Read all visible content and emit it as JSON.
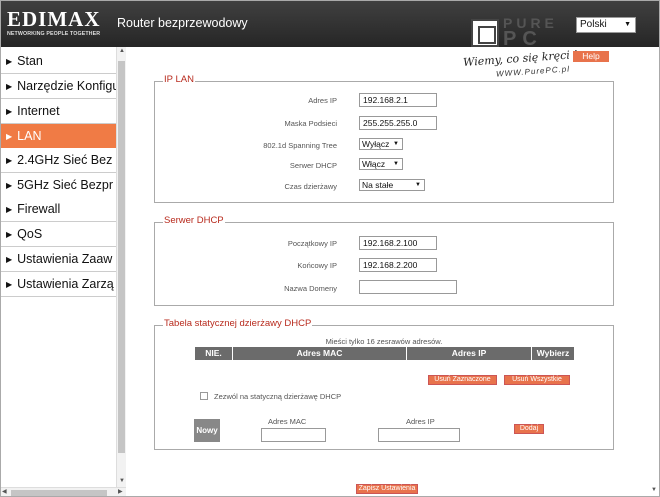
{
  "header": {
    "logo_main": "EDIMAX",
    "logo_sub": "NETWORKING PEOPLE TOGETHER",
    "title": "Router bezprzewodowy",
    "language": "Polski",
    "help_label": "Help"
  },
  "sidebar": {
    "items": [
      {
        "label": "Stan"
      },
      {
        "label": "Narzędzie Konfigu"
      },
      {
        "label": "Internet"
      },
      {
        "label": "LAN"
      },
      {
        "label": "2.4GHz Sieć Bez"
      },
      {
        "label": "5GHz Sieć Bezpr"
      },
      {
        "label": "Firewall"
      },
      {
        "label": "QoS"
      },
      {
        "label": "Ustawienia Zaaw"
      },
      {
        "label": "Ustawienia Zarzą"
      }
    ]
  },
  "ip_lan": {
    "legend": "IP LAN",
    "ip_label": "Adres IP",
    "ip_value": "192.168.2.1",
    "mask_label": "Maska Podsieci",
    "mask_value": "255.255.255.0",
    "stp_label": "802.1d Spanning Tree",
    "stp_value": "Wyłącz",
    "dhcp_label": "Serwer DHCP",
    "dhcp_value": "Włącz",
    "lease_label": "Czas dzierżawy",
    "lease_value": "Na stałe"
  },
  "dhcp_server": {
    "legend": "Serwer DHCP",
    "start_label": "Początkowy IP",
    "start_value": "192.168.2.100",
    "end_label": "Końcowy IP",
    "end_value": "192.168.2.200",
    "domain_label": "Nazwa Domeny",
    "domain_value": ""
  },
  "static_lease": {
    "legend": "Tabela statycznej dzierżawy DHCP",
    "note": "Mieści tylko 16 zesrawów adresów.",
    "columns": [
      "NIE.",
      "Adres MAC",
      "Adres IP",
      "Wybierz"
    ],
    "delete_selected": "Usuń Zaznaczone",
    "delete_all": "Usuń Wszystkie",
    "enable_label": "Zezwól na statyczną dzierżawę DHCP",
    "new_label": "Nowy",
    "mac_label": "Adres MAC",
    "ip_label": "Adres IP",
    "add_label": "Dodaj"
  },
  "footer": {
    "save_label": "Zapisz Ustawienia"
  },
  "watermark": {
    "pure": "PURE",
    "pc": "PC",
    "slogan": "Wiemy, co się kręci !",
    "url": "WWW.PurePC.pl"
  },
  "colors": {
    "accent": "#f07b45",
    "legend": "#b82b1e",
    "header": "#333333"
  }
}
